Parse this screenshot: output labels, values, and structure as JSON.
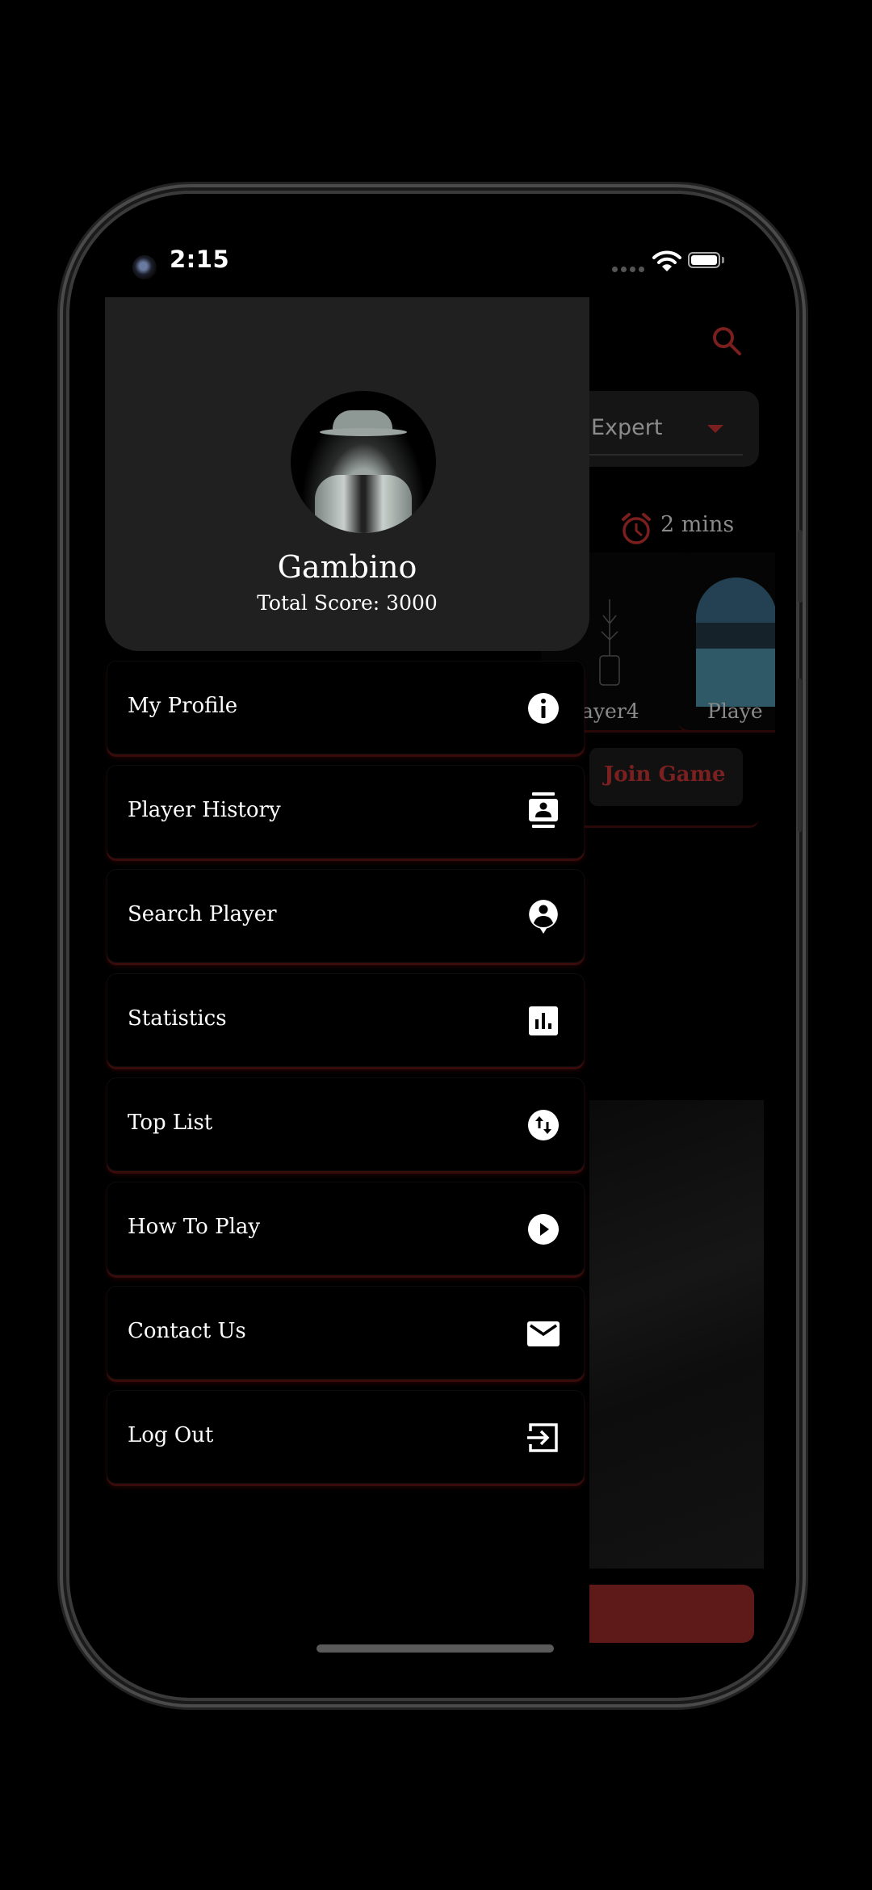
{
  "status_bar": {
    "time": "2:15",
    "icons": [
      "front-camera",
      "cellular-signal-icon",
      "wifi-icon",
      "battery-icon"
    ]
  },
  "background_screen": {
    "search_icon": "search-icon",
    "difficulty_value": "Expert",
    "timer_icon": "alarm-clock-icon",
    "timer_text": "2 mins",
    "players": [
      {
        "label": "ayer4"
      },
      {
        "label": "Playe"
      }
    ],
    "join_button": "Join Game",
    "colors": {
      "accent": "#7a1e1e",
      "button_fill": "#5e1a18"
    }
  },
  "drawer": {
    "profile": {
      "avatar": "detective-avatar",
      "name": "Gambino",
      "score_text": "Total Score: 3000"
    },
    "items": [
      {
        "label": "My Profile",
        "icon": "info-icon"
      },
      {
        "label": "Player History",
        "icon": "contact-card-icon"
      },
      {
        "label": "Search Player",
        "icon": "person-pin-icon"
      },
      {
        "label": "Statistics",
        "icon": "bar-chart-icon"
      },
      {
        "label": "Top List",
        "icon": "swap-vert-icon"
      },
      {
        "label": "How To Play",
        "icon": "play-circle-icon"
      },
      {
        "label": "Contact Us",
        "icon": "mail-icon"
      },
      {
        "label": "Log Out",
        "icon": "logout-icon"
      }
    ],
    "colors": {
      "header_bg": "#202020",
      "item_shadow": "#3a0b0b",
      "text": "#ffffff"
    }
  }
}
